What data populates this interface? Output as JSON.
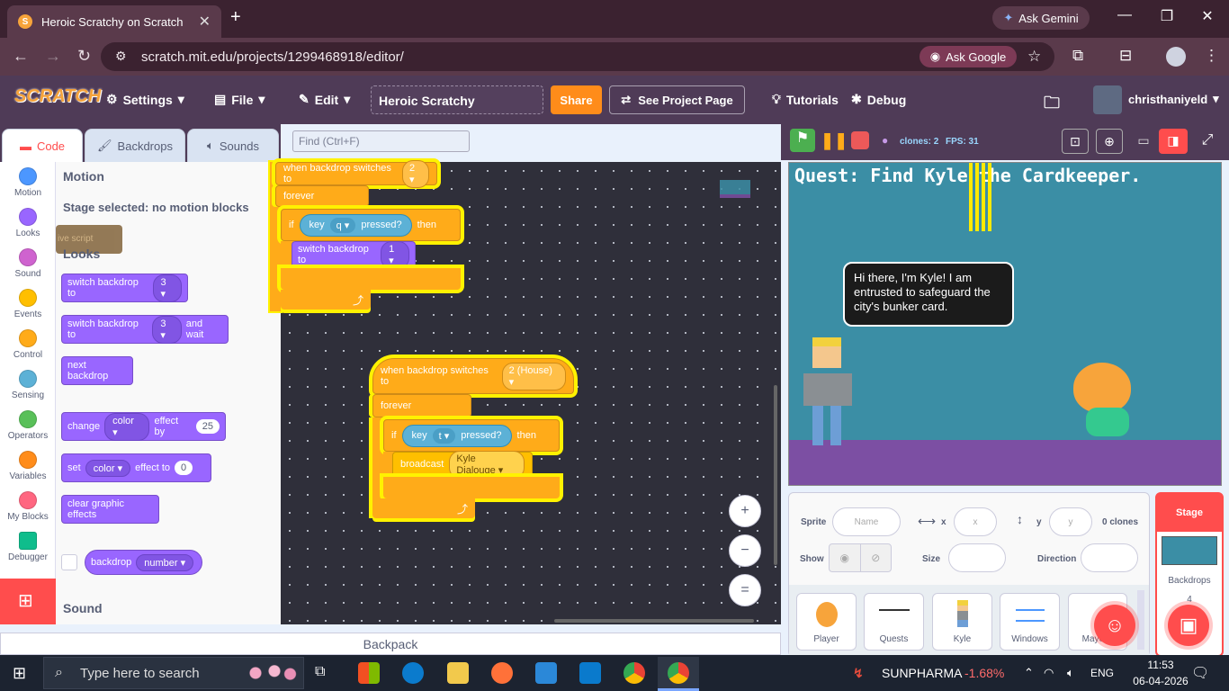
{
  "browser": {
    "tab_title": "Heroic Scratchy on Scratch",
    "tab_close": "✕",
    "new_tab": "+",
    "gemini_label": "Ask Gemini",
    "url": "scratch.mit.edu/projects/1299468918/editor/",
    "ask_google": "Ask Google"
  },
  "menubar": {
    "logo": "SCRATCH",
    "settings": "Settings",
    "file": "File",
    "edit": "Edit",
    "project_title": "Heroic Scratchy",
    "share": "Share",
    "see_project": "See Project Page",
    "tutorials": "Tutorials",
    "debug": "Debug",
    "username": "christhaniyeld"
  },
  "editor_tabs": {
    "code": "Code",
    "backdrops": "Backdrops",
    "sounds": "Sounds"
  },
  "find_placeholder": "Find (Ctrl+F)",
  "categories": [
    {
      "label": "Motion",
      "color": "#4c97ff"
    },
    {
      "label": "Looks",
      "color": "#9966ff"
    },
    {
      "label": "Sound",
      "color": "#cf63cf"
    },
    {
      "label": "Events",
      "color": "#ffbf00"
    },
    {
      "label": "Control",
      "color": "#ffab19"
    },
    {
      "label": "Sensing",
      "color": "#5cb1d6"
    },
    {
      "label": "Operators",
      "color": "#59c059"
    },
    {
      "label": "Variables",
      "color": "#ff8c1a"
    },
    {
      "label": "My Blocks",
      "color": "#ff6680"
    },
    {
      "label": "Debugger",
      "color": "#0fbd8c"
    }
  ],
  "palette": {
    "motion_heading": "Motion",
    "motion_note": "Stage selected: no motion blocks",
    "looks_heading": "Looks",
    "ghost_script": "ive script",
    "sound_heading": "Sound",
    "b1": {
      "text": "switch backdrop to",
      "dd": "3"
    },
    "b2": {
      "text": "switch backdrop to",
      "dd": "3",
      "tail": "and wait"
    },
    "b3": {
      "text": "next backdrop"
    },
    "b4": {
      "text": "change",
      "dd": "color",
      "mid": "effect by",
      "num": "25"
    },
    "b5": {
      "text": "set",
      "dd": "color",
      "mid": "effect to",
      "num": "0"
    },
    "b6": {
      "text": "clear graphic effects"
    },
    "b7": {
      "text": "backdrop",
      "dd": "number"
    }
  },
  "script1": {
    "hat": "when backdrop switches to",
    "hat_dd": "2",
    "forever": "forever",
    "if": "if",
    "key": "key",
    "key_dd": "q",
    "pressed": "pressed?",
    "then": "then",
    "action": "switch backdrop to",
    "action_dd": "1"
  },
  "script2": {
    "hat": "when backdrop switches to",
    "hat_dd": "2 (House)",
    "forever": "forever",
    "if": "if",
    "key": "key",
    "key_dd": "t",
    "pressed": "pressed?",
    "then": "then",
    "action": "broadcast",
    "action_dd": "Kyle Dialouge"
  },
  "zoom": {
    "in": "+",
    "out": "−",
    "reset": "="
  },
  "backpack": "Backpack",
  "stage_header": {
    "clones": "clones: 2",
    "fps": "FPS: 31"
  },
  "stage": {
    "quest": "Quest: Find Kyle the Cardkeeper.",
    "speech": "Hi there, I'm Kyle! I am entrusted to safeguard the city's bunker card."
  },
  "sprite_info": {
    "sprite_label": "Sprite",
    "name_placeholder": "Name",
    "x_label": "x",
    "x_placeholder": "x",
    "y_label": "y",
    "y_placeholder": "y",
    "clones": "0 clones",
    "show_label": "Show",
    "size_label": "Size",
    "direction_label": "Direction"
  },
  "sprites": [
    "Player",
    "Quests",
    "Kyle",
    "Windows",
    "Mayor's"
  ],
  "stage_pane": {
    "label": "Stage",
    "backdrops": "Backdrops",
    "count": "4"
  },
  "taskbar": {
    "search": "Type here to search",
    "stock_name": "SUNPHARMA",
    "stock_change": "-1.68%",
    "lang": "ENG",
    "time": "11:53",
    "date": "06-04-2026"
  }
}
